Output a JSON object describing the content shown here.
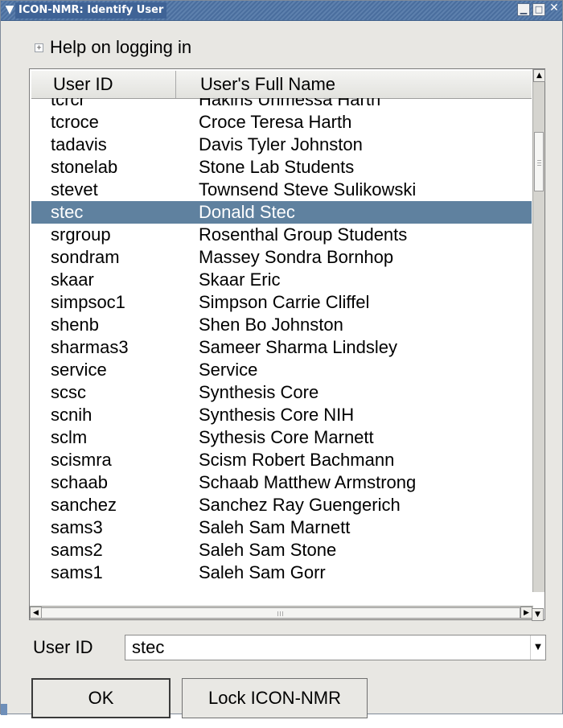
{
  "window": {
    "title": "ICON-NMR: Identify User",
    "menu_icon": "chevron-down-icon",
    "controls": [
      "minimize-icon",
      "maximize-icon",
      "close-icon"
    ]
  },
  "help": {
    "icon": "expand-plus-icon",
    "label": "Help on logging in"
  },
  "table": {
    "columns": [
      "User ID",
      "User's Full Name"
    ],
    "rows": [
      {
        "id": "tcrcr",
        "name": "Hakins Unmessa Harth"
      },
      {
        "id": "tcroce",
        "name": "Croce Teresa Harth"
      },
      {
        "id": "tadavis",
        "name": "Davis Tyler Johnston"
      },
      {
        "id": "stonelab",
        "name": "Stone Lab Students"
      },
      {
        "id": "stevet",
        "name": "Townsend Steve Sulikowski"
      },
      {
        "id": "stec",
        "name": "Donald Stec"
      },
      {
        "id": "srgroup",
        "name": "Rosenthal Group Students"
      },
      {
        "id": "sondram",
        "name": "Massey Sondra Bornhop"
      },
      {
        "id": "skaar",
        "name": "Skaar Eric"
      },
      {
        "id": "simpsoc1",
        "name": "Simpson Carrie Cliffel"
      },
      {
        "id": "shenb",
        "name": "Shen Bo Johnston"
      },
      {
        "id": "sharmas3",
        "name": "Sameer Sharma Lindsley"
      },
      {
        "id": "service",
        "name": "Service"
      },
      {
        "id": "scsc",
        "name": "Synthesis Core"
      },
      {
        "id": "scnih",
        "name": "Synthesis Core NIH"
      },
      {
        "id": "sclm",
        "name": "Sythesis Core Marnett"
      },
      {
        "id": "scismra",
        "name": "Scism Robert Bachmann"
      },
      {
        "id": "schaab",
        "name": "Schaab Matthew Armstrong"
      },
      {
        "id": "sanchez",
        "name": "Sanchez Ray Guengerich"
      },
      {
        "id": "sams3",
        "name": "Saleh Sam Marnett"
      },
      {
        "id": "sams2",
        "name": "Saleh Sam Stone"
      },
      {
        "id": "sams1",
        "name": "Saleh Sam Gorr"
      }
    ],
    "selected_id": "stec"
  },
  "user_id": {
    "label": "User ID",
    "value": "stec"
  },
  "buttons": {
    "ok": "OK",
    "lock": "Lock ICON-NMR"
  },
  "colors": {
    "titlebar": "#4a6e9e",
    "selection": "#5f819f",
    "window_bg": "#e8e7e3"
  }
}
